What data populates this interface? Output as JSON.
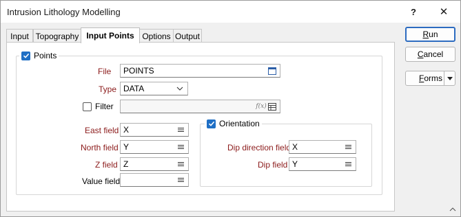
{
  "window": {
    "title": "Intrusion Lithology Modelling",
    "help_label": "?",
    "close_label": "✕"
  },
  "tabs": [
    {
      "label": "Input"
    },
    {
      "label": "Topography"
    },
    {
      "label": "Input Points"
    },
    {
      "label": "Options"
    },
    {
      "label": "Output"
    }
  ],
  "active_tab": "Input Points",
  "points_group": {
    "label": "Points",
    "checked": true,
    "file": {
      "label": "File",
      "value": "POINTS"
    },
    "type": {
      "label": "Type",
      "value": "DATA"
    },
    "filter": {
      "label": "Filter",
      "checked": false,
      "value": "",
      "expr_icon": "f(x)"
    },
    "east_field": {
      "label": "East field",
      "value": "X"
    },
    "north_field": {
      "label": "North field",
      "value": "Y"
    },
    "z_field": {
      "label": "Z field",
      "value": "Z"
    },
    "value_field": {
      "label": "Value field",
      "value": ""
    }
  },
  "orientation_group": {
    "label": "Orientation",
    "checked": true,
    "dip_direction_field": {
      "label": "Dip direction field",
      "value": "X"
    },
    "dip_field": {
      "label": "Dip field",
      "value": "Y"
    }
  },
  "buttons": {
    "run": {
      "label_u": "R",
      "label_rest": "un"
    },
    "cancel": {
      "label_u": "C",
      "label_rest": "ancel"
    },
    "forms": {
      "label_u": "F",
      "label_rest": "orms"
    }
  },
  "colors": {
    "accent": "#1f6fc5",
    "required_label": "#8b1a1a",
    "default_button_border": "#2c6bc0"
  },
  "icons": {
    "file_browse": "calendar-like-file-icon",
    "dropdown": "chevron-down-icon",
    "field_list": "list-icon",
    "expression": "function-icon",
    "filter_table": "table-icon"
  }
}
